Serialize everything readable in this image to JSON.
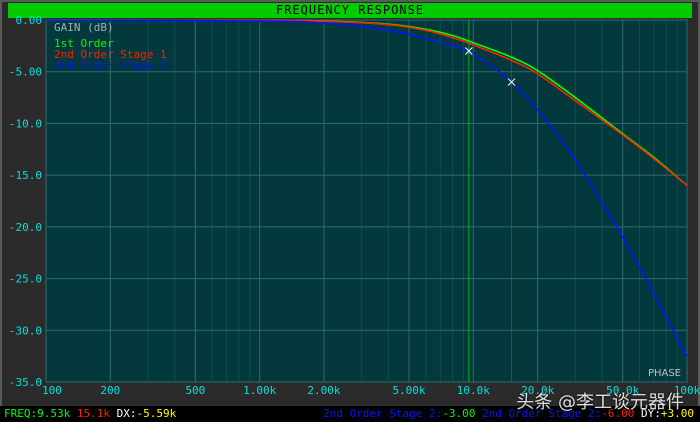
{
  "title": "FREQUENCY RESPONSE",
  "phase_label": "PHASE",
  "chart_data": {
    "type": "line",
    "ylabel": "GAIN (dB)",
    "xscale": "log",
    "xlim": [
      100,
      100000
    ],
    "ylim": [
      -35,
      0
    ],
    "grid": true,
    "legend_position": "top-left",
    "x_tick_labels": [
      "100",
      "200",
      "500",
      "1.00k",
      "2.00k",
      "5.00k",
      "10.0k",
      "20.0k",
      "50.0k",
      "100k"
    ],
    "x_tick_values": [
      100,
      200,
      500,
      1000,
      2000,
      5000,
      10000,
      20000,
      50000,
      100000
    ],
    "y_tick_labels": [
      "0.00",
      "-5.00",
      "-10.0",
      "-15.0",
      "-20.0",
      "-25.0",
      "-30.0",
      "-35.0"
    ],
    "y_tick_values": [
      0,
      -5,
      -10,
      -15,
      -20,
      -25,
      -30,
      -35
    ],
    "series": [
      {
        "name": "1st Order",
        "color": "#00ff00",
        "x": [
          100,
          1000,
          2000,
          4000,
          6000,
          8000,
          10000,
          15100,
          20000,
          30000,
          50000,
          70000,
          100000
        ],
        "y": [
          0,
          -0.05,
          -0.1,
          -0.4,
          -0.9,
          -1.5,
          -2.2,
          -3.6,
          -4.9,
          -7.5,
          -11.0,
          -13.3,
          -16.0
        ]
      },
      {
        "name": "2nd Order Stage 1",
        "color": "#ff2000",
        "x": [
          100,
          1000,
          2000,
          4000,
          6000,
          8000,
          10000,
          15100,
          20000,
          30000,
          50000,
          70000,
          100000
        ],
        "y": [
          0,
          -0.05,
          -0.12,
          -0.45,
          -1.0,
          -1.7,
          -2.4,
          -3.9,
          -5.2,
          -7.8,
          -11.1,
          -13.4,
          -16.0
        ]
      },
      {
        "name": "2nd Order Stage 2",
        "color": "#0018ff",
        "x": [
          100,
          1000,
          2000,
          4000,
          6000,
          8000,
          9530,
          12000,
          15100,
          20000,
          30000,
          50000,
          70000,
          100000
        ],
        "y": [
          0,
          -0.1,
          -0.3,
          -1.0,
          -1.8,
          -2.5,
          -3.0,
          -4.4,
          -6.0,
          -8.7,
          -13.5,
          -21.0,
          -26.5,
          -32.5
        ]
      }
    ],
    "cursors": [
      {
        "x": 9530,
        "color": "#00ff00",
        "mark_y": -3.0
      },
      {
        "x": 15100,
        "color": "#ff2000",
        "mark_y": -6.0
      }
    ]
  },
  "status": {
    "freq_label": "FREQ:",
    "freq1": "9.53k",
    "freq2": "15.1k",
    "dx_label": "DX:",
    "dx": "-5.59k",
    "trace1_label": "2nd Order Stage 2:",
    "trace1_value": "-3.00",
    "trace2_label": "2nd Order Stage 2:",
    "trace2_value": "-6.00",
    "dy_label": "DY:",
    "dy": "+3.00"
  },
  "watermark": "头条 @李工谈元器件"
}
